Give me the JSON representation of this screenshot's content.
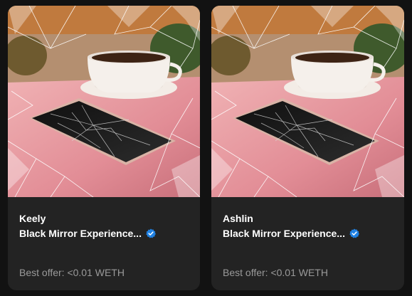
{
  "cards": [
    {
      "owner": "Keely",
      "collection": "Black Mirror Experience...",
      "verified_icon": "verified-badge-icon",
      "offer": "Best offer: <0.01 WETH",
      "image_alt": "Shattered phone on pink marble table with coffee cup"
    },
    {
      "owner": "Ashlin",
      "collection": "Black Mirror Experience...",
      "verified_icon": "verified-badge-icon",
      "offer": "Best offer: <0.01 WETH",
      "image_alt": "Shattered phone on pink marble table with coffee cup"
    }
  ],
  "colors": {
    "background": "#121212",
    "card": "#232323",
    "text": "#ffffff",
    "muted": "#9a9a9a",
    "verified": "#2081e2"
  }
}
